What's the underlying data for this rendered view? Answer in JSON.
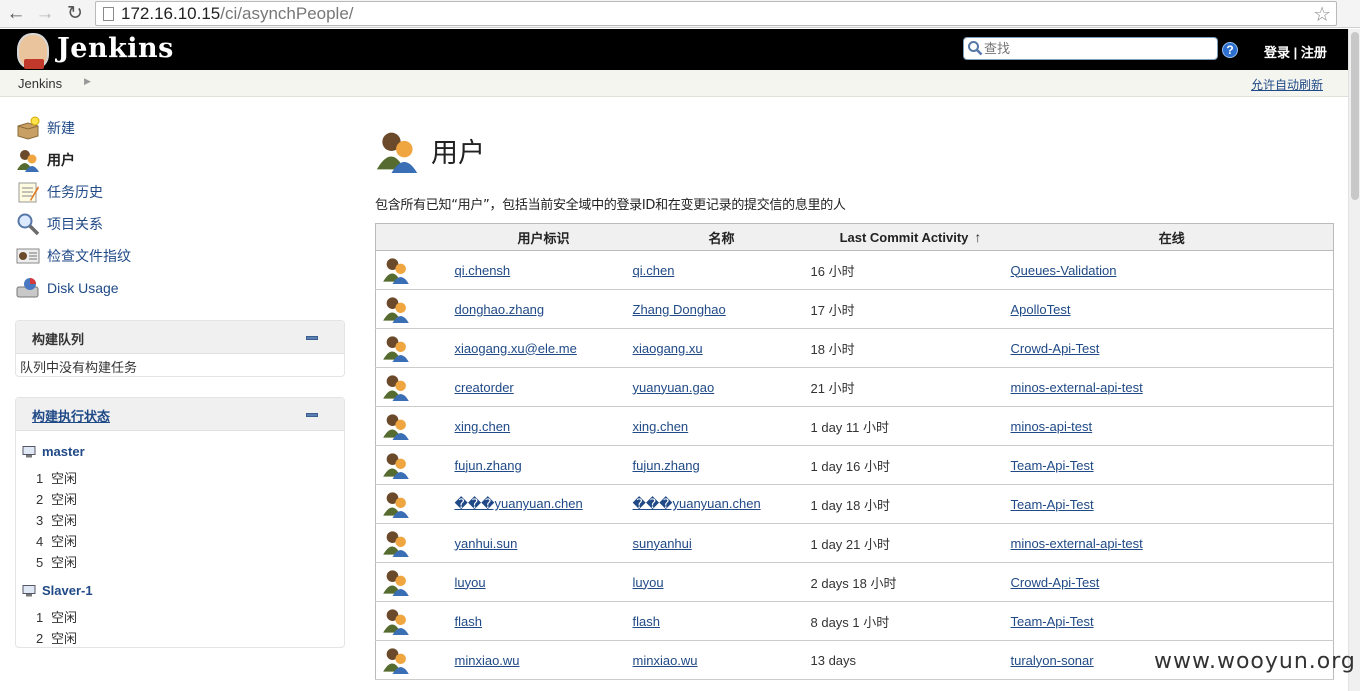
{
  "browser": {
    "url_host": "172.16.10.15",
    "url_path": "/ci/asynchPeople/"
  },
  "header": {
    "logo_text": "Jenkins",
    "search_placeholder": "查找",
    "login": "登录",
    "separator": "|",
    "register": "注册"
  },
  "breadcrumb": {
    "root": "Jenkins",
    "auto_refresh": "允许自动刷新"
  },
  "sidebar": {
    "tasks": [
      {
        "label": "新建",
        "icon": "new-package-icon"
      },
      {
        "label": "用户",
        "icon": "users-icon",
        "current": true
      },
      {
        "label": "任务历史",
        "icon": "notepad-icon"
      },
      {
        "label": "项目关系",
        "icon": "magnifier-icon"
      },
      {
        "label": "检查文件指纹",
        "icon": "fingerprint-icon"
      },
      {
        "label": "Disk Usage",
        "icon": "disk-usage-icon"
      }
    ],
    "build_queue": {
      "title": "构建队列",
      "empty_message": "队列中没有构建任务"
    },
    "executors": {
      "title": "构建执行状态",
      "nodes": [
        {
          "name": "master",
          "executors": [
            {
              "num": "1",
              "status": "空闲"
            },
            {
              "num": "2",
              "status": "空闲"
            },
            {
              "num": "3",
              "status": "空闲"
            },
            {
              "num": "4",
              "status": "空闲"
            },
            {
              "num": "5",
              "status": "空闲"
            }
          ]
        },
        {
          "name": "Slaver-1",
          "executors": [
            {
              "num": "1",
              "status": "空闲"
            },
            {
              "num": "2",
              "status": "空闲"
            }
          ]
        }
      ]
    }
  },
  "main": {
    "title": "用户",
    "description": "包含所有已知“用户”，包括当前安全域中的登录ID和在变更记录的提交信的息里的人",
    "columns": {
      "user_id": "用户标识",
      "name": "名称",
      "last_commit": "Last Commit Activity",
      "sort_indicator": "↑",
      "online": "在线"
    },
    "rows": [
      {
        "user_id": "qi.chensh",
        "name": "qi.chen",
        "activity": "16 小时",
        "project": "Queues-Validation"
      },
      {
        "user_id": "donghao.zhang",
        "name": "Zhang Donghao",
        "activity": "17 小时",
        "project": "ApolloTest"
      },
      {
        "user_id": "xiaogang.xu@ele.me",
        "name": "xiaogang.xu",
        "activity": "18 小时",
        "project": "Crowd-Api-Test"
      },
      {
        "user_id": "creatorder",
        "name": "yuanyuan.gao",
        "activity": "21 小时",
        "project": "minos-external-api-test"
      },
      {
        "user_id": "xing.chen",
        "name": "xing.chen",
        "activity": "1 day 11 小时",
        "project": "minos-api-test"
      },
      {
        "user_id": "fujun.zhang",
        "name": "fujun.zhang",
        "activity": "1 day 16 小时",
        "project": "Team-Api-Test"
      },
      {
        "user_id": "���yuanyuan.chen",
        "name": "���yuanyuan.chen",
        "activity": "1 day 18 小时",
        "project": "Team-Api-Test"
      },
      {
        "user_id": "yanhui.sun",
        "name": "sunyanhui",
        "activity": "1 day 21 小时",
        "project": "minos-external-api-test"
      },
      {
        "user_id": "luyou",
        "name": "luyou",
        "activity": "2 days 18 小时",
        "project": "Crowd-Api-Test"
      },
      {
        "user_id": "flash",
        "name": "flash",
        "activity": "8 days 1 小时",
        "project": "Team-Api-Test"
      },
      {
        "user_id": "minxiao.wu",
        "name": "minxiao.wu",
        "activity": "13 days",
        "project": "turalyon-sonar"
      }
    ]
  },
  "watermark": "www.wooyun.org"
}
